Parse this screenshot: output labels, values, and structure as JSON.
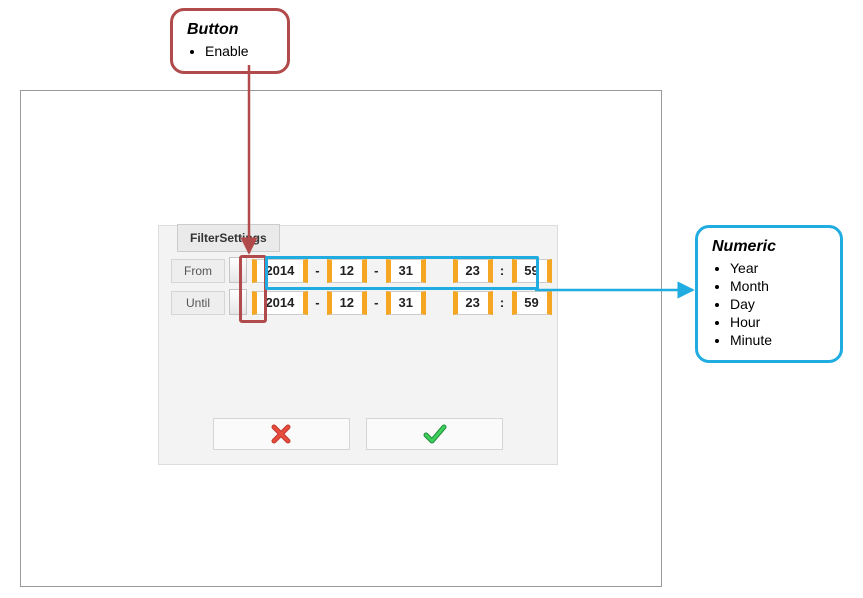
{
  "callout_button": {
    "title": "Button",
    "items": [
      "Enable"
    ]
  },
  "callout_numeric": {
    "title": "Numeric",
    "items": [
      "Year",
      "Month",
      "Day",
      "Hour",
      "Minute"
    ]
  },
  "dialog": {
    "tab_label": "FilterSettings",
    "rows": [
      {
        "label": "From",
        "year": "2014",
        "month": "12",
        "day": "31",
        "hour": "23",
        "minute": "59"
      },
      {
        "label": "Until",
        "year": "2014",
        "month": "12",
        "day": "31",
        "hour": "23",
        "minute": "59"
      }
    ],
    "sep_date": "-",
    "sep_time": ":"
  }
}
